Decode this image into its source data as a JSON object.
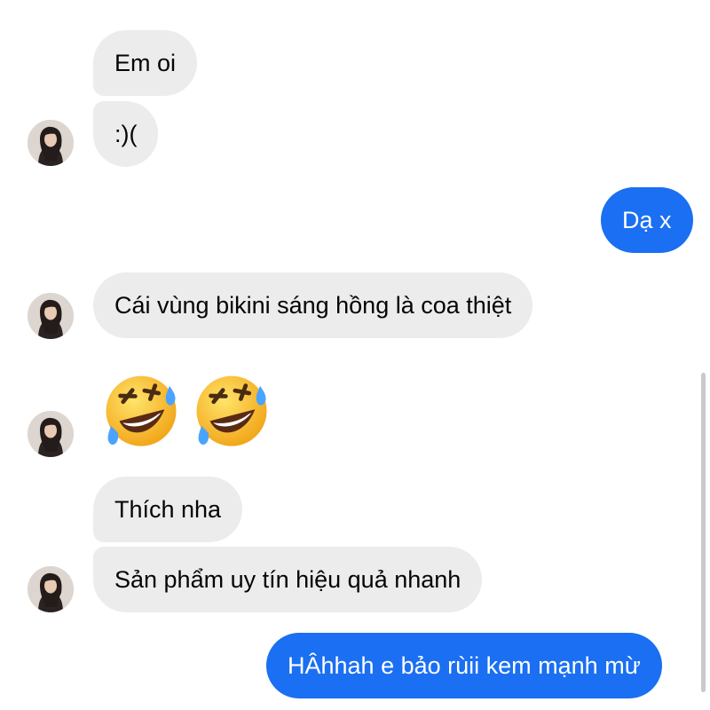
{
  "conversation": {
    "messages": [
      {
        "from": "contact",
        "text": "Em oi"
      },
      {
        "from": "contact",
        "text": ":)("
      },
      {
        "from": "me",
        "text": "Dạ x"
      },
      {
        "from": "contact",
        "text": "Cái vùng bikini sáng hồng là coa thiệt"
      },
      {
        "from": "contact",
        "emojis": [
          "rolling-on-floor-laughing",
          "rolling-on-floor-laughing"
        ]
      },
      {
        "from": "contact",
        "text": "Thích nha"
      },
      {
        "from": "contact",
        "text": "Sản phẩm uy tín hiệu quả nhanh"
      },
      {
        "from": "me",
        "text": "HÂhhah e bảo rùii kem mạnh mừ"
      }
    ]
  },
  "colors": {
    "incoming_bubble": "#ececec",
    "outgoing_bubble": "#1a6ff2",
    "background": "#ffffff"
  },
  "icons": {
    "avatar": "contact-avatar-photo",
    "emoji": "rolling-on-the-floor-laughing-emoji"
  }
}
